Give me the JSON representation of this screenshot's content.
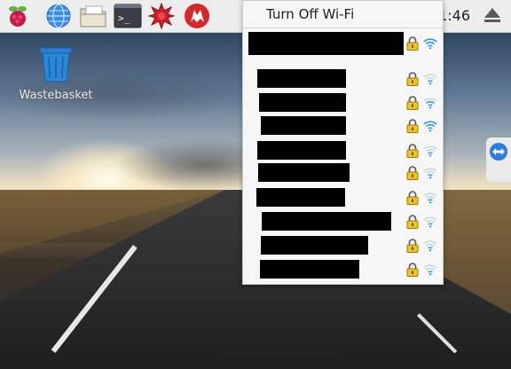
{
  "panel": {
    "launchers": [
      {
        "name": "raspberry-menu-icon"
      },
      {
        "name": "web-browser-icon"
      },
      {
        "name": "file-manager-icon"
      },
      {
        "name": "terminal-icon"
      },
      {
        "name": "wolfram-icon"
      },
      {
        "name": "mathematica-icon"
      }
    ],
    "clock": "1:46",
    "eject_icon": "eject-icon"
  },
  "desktop": {
    "trash_label": "Wastebasket"
  },
  "wifi_menu": {
    "toggle_label": "Turn Off Wi-Fi",
    "networks": [
      {
        "ssid": "",
        "secured": true,
        "connected": true,
        "signal": "strong"
      },
      {
        "ssid": "",
        "secured": true,
        "signal": "weak"
      },
      {
        "ssid": "",
        "secured": true,
        "signal": "medium"
      },
      {
        "ssid": "",
        "secured": true,
        "signal": "strong"
      },
      {
        "ssid": "",
        "secured": true,
        "signal": "weak"
      },
      {
        "ssid": "",
        "secured": true,
        "signal": "weak"
      },
      {
        "ssid": "",
        "secured": true,
        "signal": "weak"
      },
      {
        "ssid": "",
        "secured": true,
        "signal": "weak"
      },
      {
        "ssid": "",
        "secured": true,
        "signal": "weak"
      },
      {
        "ssid": "",
        "secured": true,
        "signal": "weak"
      }
    ]
  },
  "colors": {
    "panel_bg": "#ededed",
    "menu_bg": "#f6f6f6",
    "wifi_blue": "#2d9be0",
    "lock_yellow": "#f1c31c"
  }
}
